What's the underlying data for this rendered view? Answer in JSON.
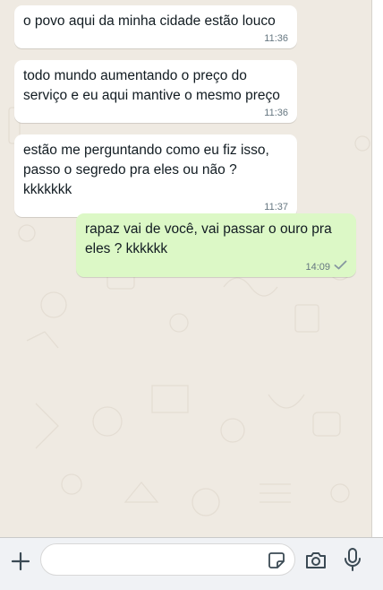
{
  "messages": [
    {
      "direction": "in",
      "text": "o povo aqui da minha cidade estão louco",
      "time": "11:36"
    },
    {
      "direction": "in",
      "text": "todo mundo aumentando o preço do serviço e eu aqui mantive o mesmo preço",
      "time": "11:36"
    },
    {
      "direction": "in",
      "text": "estão me perguntando como eu fiz isso, passo o segredo pra eles ou não ? kkkkkkk",
      "time": "11:37"
    },
    {
      "direction": "out",
      "text": "rapaz vai de você, vai passar o ouro pra eles ? kkkkkk",
      "time": "14:09",
      "status": "sent-single-check"
    }
  ],
  "composer": {
    "input_value": "",
    "icons": [
      "plus-icon",
      "sticker-icon",
      "camera-icon",
      "mic-icon"
    ]
  },
  "colors": {
    "chat_background": "#efeae2",
    "incoming_bubble": "#ffffff",
    "outgoing_bubble": "#dcf8c6",
    "timestamp": "#667781",
    "composer_bar": "#f0f2f5"
  }
}
